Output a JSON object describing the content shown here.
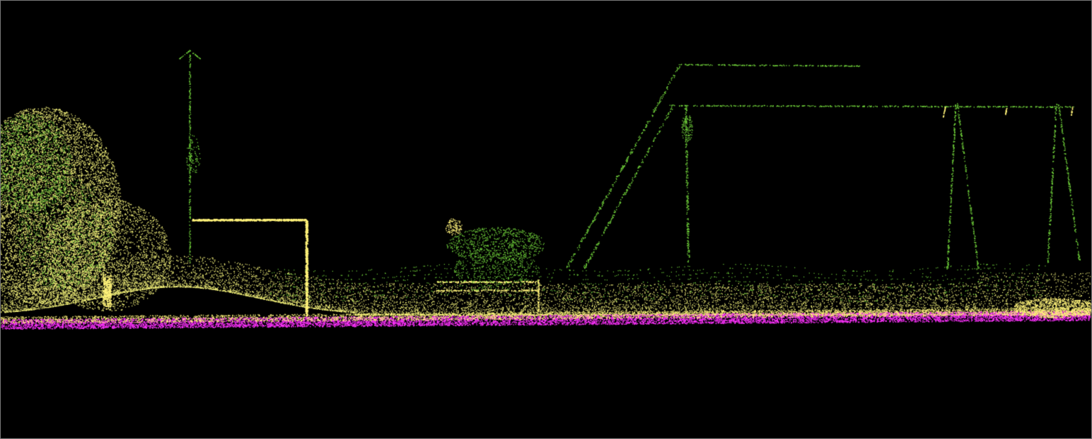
{
  "scene": {
    "description_visible_text": "",
    "background_color": "#000000",
    "border_color": "#7a7a7a",
    "classes": [
      {
        "id": "ground",
        "color": "#ff33ff"
      },
      {
        "id": "vegetation",
        "color": "#f2f07a"
      },
      {
        "id": "structure",
        "color": "#6fcf3a"
      },
      {
        "id": "highlight",
        "color": "#fff27a"
      }
    ]
  }
}
